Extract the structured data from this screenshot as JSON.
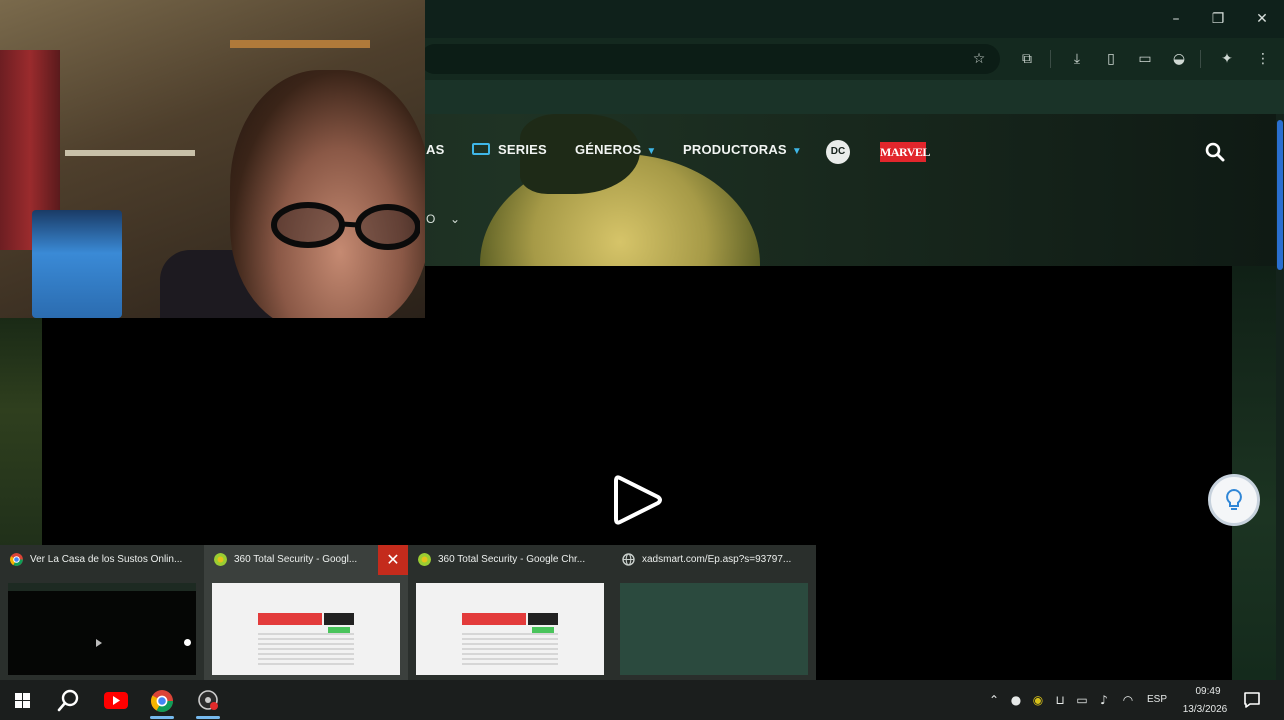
{
  "nav": {
    "item_as": "AS",
    "series": "SERIES",
    "generos": "GÉNEROS",
    "productoras": "PRODUCTORAS",
    "dc": "DC",
    "marvel": "MARVEL",
    "sub_label": "O"
  },
  "thumbnails": [
    {
      "title": "Ver La Casa de los Sustos Onlin...",
      "icon": "chrome-icon"
    },
    {
      "title": "360 Total Security - Googl...",
      "icon": "360-icon"
    },
    {
      "title": "360 Total Security - Google Chr...",
      "icon": "360-icon"
    },
    {
      "title": "xadsmart.com/Ep.asp?s=93797...",
      "icon": "globe-icon"
    }
  ],
  "tray": {
    "lang": "ESP",
    "time": "09:49",
    "date": "13/3/2026"
  },
  "colors": {
    "accent": "#3fb7e8",
    "marvel": "#e2262c",
    "close_hover": "#c42b1c"
  }
}
